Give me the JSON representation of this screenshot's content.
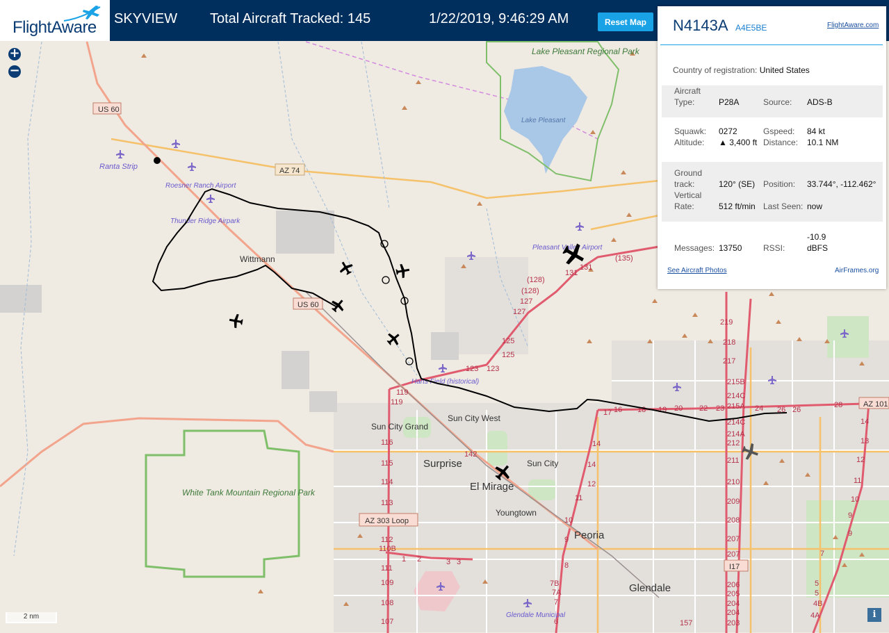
{
  "header": {
    "logo_text": "FlightAware",
    "app_title": "SKYVIEW",
    "tracked_label": "Total Aircraft Tracked:",
    "tracked_count": "145",
    "datetime": "1/22/2019, 9:46:29 AM",
    "reset_label": "Reset Map"
  },
  "colors": {
    "topbar": "#002f5d",
    "accent": "#1aa2e6",
    "route": "#e05b6e",
    "park": "#7fbf6a"
  },
  "map": {
    "zoom_in": "+",
    "zoom_out": "−",
    "scale_label": "2 nm",
    "info_icon": "i",
    "places": {
      "lake_pleasant_park": "Lake Pleasant Regional Park",
      "lake_pleasant": "Lake Pleasant",
      "ranta_strip": "Ranta Strip",
      "roesner": "Roesner Ranch Airport",
      "thunder_ridge": "Thunder Ridge Airpark",
      "wittmann": "Wittmann",
      "pleasant_valley": "Pleasant Valley Airport",
      "harts_field": "Harts Field (historical)",
      "sun_city_grand": "Sun City Grand",
      "sun_city_west": "Sun City West",
      "surprise": "Surprise",
      "sun_city": "Sun City",
      "el_mirage": "El Mirage",
      "youngtown": "Youngtown",
      "peoria": "Peoria",
      "glendale": "Glendale",
      "glendale_municipal": "Glendale Municipal",
      "white_tank": "White Tank Mountain Regional Park"
    },
    "shields": {
      "us60_a": "US 60",
      "az74": "AZ 74",
      "us60_b": "US 60",
      "az303": "AZ 303 Loop",
      "az101": "AZ 101",
      "i17": "I17"
    }
  },
  "panel": {
    "ident": "N4143A",
    "hex": "A4E5BE",
    "fa_link": "FlightAware.com",
    "country_label": "Country of registration:",
    "country_value": "United States",
    "aircraft_type_label_1": "Aircraft",
    "aircraft_type_label_2": "Type:",
    "aircraft_type": "P28A",
    "source_label": "Source:",
    "source": "ADS-B",
    "squawk_label": "Squawk:",
    "squawk": "0272",
    "gspeed_label": "Gspeed:",
    "gspeed": "84 kt",
    "altitude_label": "Altitude:",
    "altitude": "▲ 3,400 ft",
    "distance_label": "Distance:",
    "distance": "10.1 NM",
    "ground_track_label_1": "Ground",
    "ground_track_label_2": "track:",
    "ground_track": "120° (SE)",
    "position_label": "Position:",
    "position": "33.744°, -112.462°",
    "vrate_label_1": "Vertical",
    "vrate_label_2": "Rate:",
    "vrate": "512 ft/min",
    "last_seen_label": "Last Seen:",
    "last_seen": "now",
    "messages_label": "Messages:",
    "messages": "13750",
    "rssi_label": "RSSI:",
    "rssi_1": "-10.9",
    "rssi_2": "dBFS",
    "photos_link": "See Aircraft Photos",
    "airframes_link": "AirFrames.org"
  }
}
